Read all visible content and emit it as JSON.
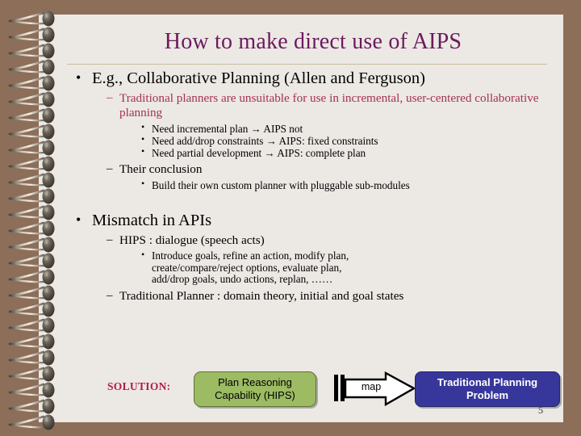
{
  "slide": {
    "title": "How to make direct use of AIPS",
    "page_number": "5",
    "colors": {
      "background": "#8d6e58",
      "page": "#ece8e4",
      "title": "#6b1a5e",
      "accent_crimson": "#a33252",
      "solution_red": "#b01f45",
      "green_box": "#9cbb63",
      "blue_box": "#37379b",
      "rule": "#c9bd9c"
    }
  },
  "outline": {
    "bullet_glyph": "•",
    "dash_glyph": "–",
    "sub_bullet_glyph": "•",
    "arrow_glyph": "→",
    "item1": {
      "text": "E.g., Collaborative Planning (Allen and Ferguson)",
      "sub1": {
        "text": "Traditional planners are unsuitable for use in incremental, user-centered collaborative planning",
        "points": [
          "Need incremental plan → AIPS not",
          "Need add/drop constraints → AIPS: fixed constraints",
          "Need partial development → AIPS: complete plan"
        ]
      },
      "sub2": {
        "text": "Their conclusion",
        "points": [
          "Build their own custom planner with pluggable sub-modules"
        ]
      }
    },
    "item2": {
      "text": "Mismatch in APIs",
      "sub1": {
        "text": "HIPS : dialogue (speech acts)",
        "points": [
          "Introduce goals, refine an action, modify plan,",
          "create/compare/reject options, evaluate plan,",
          "add/drop goals, undo actions, replan, ……"
        ]
      },
      "sub2": {
        "text": "Traditional Planner : domain theory, initial and goal states"
      }
    }
  },
  "diagram": {
    "solution_label": "SOLUTION:",
    "green_box": {
      "line1": "Plan Reasoning",
      "line2": "Capability (HIPS)"
    },
    "arrow_label": "map",
    "blue_box": {
      "line1": "Traditional Planning",
      "line2": "Problem"
    }
  }
}
